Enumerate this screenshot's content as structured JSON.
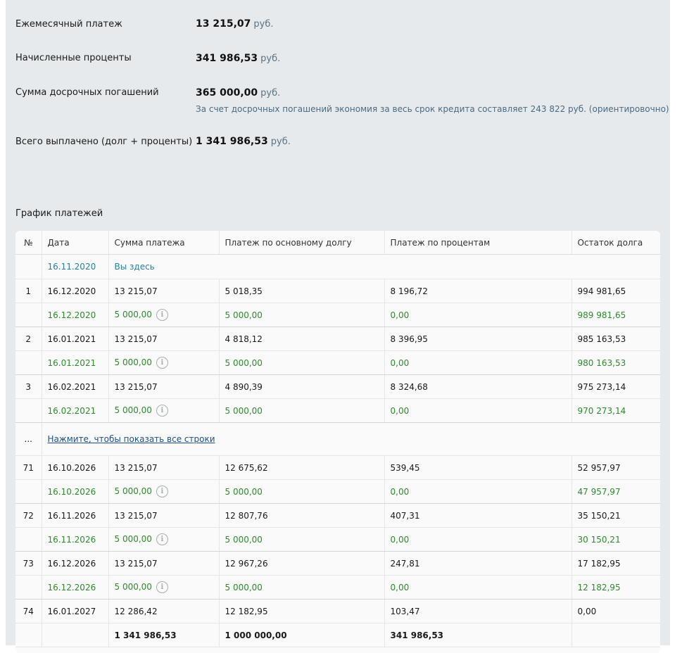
{
  "summary": {
    "monthly": {
      "label": "Ежемесячный платеж",
      "value": "13 215,07",
      "unit": "руб."
    },
    "interest": {
      "label": "Начисленные проценты",
      "value": "341 986,53",
      "unit": "руб."
    },
    "early": {
      "label": "Сумма досрочных погашений",
      "value": "365 000,00",
      "unit": "руб.",
      "note": "За счет досрочных погашений экономия за весь срок кредита составляет 243 822 руб. (ориентировочно)"
    },
    "total": {
      "label": "Всего выплачено (долг + проценты)",
      "value": "1 341 986,53",
      "unit": "руб."
    }
  },
  "schedule": {
    "title": "График платежей",
    "headers": [
      "№",
      "Дата",
      "Сумма платежа",
      "Платеж по основному долгу",
      "Платеж по процентам",
      "Остаток долга"
    ],
    "now_row": {
      "date": "16.11.2020",
      "label": "Вы здесь"
    },
    "show_all_link": "Нажмите, чтобы показать все строки",
    "ellipsis": "...",
    "rows_top": [
      {
        "n": "1",
        "date": "16.12.2020",
        "sum": "13 215,07",
        "principal": "5 018,35",
        "interest": "8 196,72",
        "rest": "994 981,65"
      },
      {
        "early": true,
        "date": "16.12.2020",
        "sum": "5 000,00",
        "principal": "5 000,00",
        "interest": "0,00",
        "rest": "989 981,65"
      },
      {
        "n": "2",
        "date": "16.01.2021",
        "sum": "13 215,07",
        "principal": "4 818,12",
        "interest": "8 396,95",
        "rest": "985 163,53"
      },
      {
        "early": true,
        "date": "16.01.2021",
        "sum": "5 000,00",
        "principal": "5 000,00",
        "interest": "0,00",
        "rest": "980 163,53"
      },
      {
        "n": "3",
        "date": "16.02.2021",
        "sum": "13 215,07",
        "principal": "4 890,39",
        "interest": "8 324,68",
        "rest": "975 273,14"
      },
      {
        "early": true,
        "date": "16.02.2021",
        "sum": "5 000,00",
        "principal": "5 000,00",
        "interest": "0,00",
        "rest": "970 273,14"
      }
    ],
    "rows_bottom": [
      {
        "n": "71",
        "date": "16.10.2026",
        "sum": "13 215,07",
        "principal": "12 675,62",
        "interest": "539,45",
        "rest": "52 957,97"
      },
      {
        "early": true,
        "date": "16.10.2026",
        "sum": "5 000,00",
        "principal": "5 000,00",
        "interest": "0,00",
        "rest": "47 957,97"
      },
      {
        "n": "72",
        "date": "16.11.2026",
        "sum": "13 215,07",
        "principal": "12 807,76",
        "interest": "407,31",
        "rest": "35 150,21"
      },
      {
        "early": true,
        "date": "16.11.2026",
        "sum": "5 000,00",
        "principal": "5 000,00",
        "interest": "0,00",
        "rest": "30 150,21"
      },
      {
        "n": "73",
        "date": "16.12.2026",
        "sum": "13 215,07",
        "principal": "12 967,26",
        "interest": "247,81",
        "rest": "17 182,95"
      },
      {
        "early": true,
        "date": "16.12.2026",
        "sum": "5 000,00",
        "principal": "5 000,00",
        "interest": "0,00",
        "rest": "12 182,95"
      },
      {
        "n": "74",
        "date": "16.01.2027",
        "sum": "12 286,42",
        "principal": "12 182,95",
        "interest": "103,47",
        "rest": "0,00"
      }
    ],
    "totals": {
      "sum": "1 341 986,53",
      "principal": "1 000 000,00",
      "interest": "341 986,53"
    }
  },
  "colors": {
    "early_payment": "#2e8b2e",
    "now_row": "#2a7fa0",
    "link": "#1d4f8a",
    "panel_bg": "#e6eaed"
  },
  "icons": {
    "early_info": "info-icon"
  }
}
